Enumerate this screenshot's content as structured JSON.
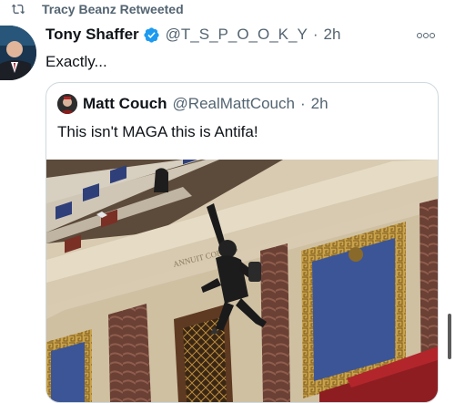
{
  "retweet": {
    "label": "Tracy Beanz Retweeted",
    "icon": "retweet-icon"
  },
  "tweet": {
    "author_name": "Tony Shaffer",
    "handle": "@T_S_P_O_O_K_Y",
    "separator": "·",
    "time": "2h",
    "text": "Exactly...",
    "verified": true
  },
  "quoted": {
    "author_name": "Matt Couch",
    "handle": "@RealMattCouch",
    "separator": "·",
    "time": "2h",
    "text": "This isn't MAGA this is Antifa!"
  },
  "media": {
    "panel_inscription": "ANNUIT COEPTIS"
  },
  "colors": {
    "muted": "#536471",
    "verified": "#1d9bf0",
    "border": "#cfd9de"
  }
}
